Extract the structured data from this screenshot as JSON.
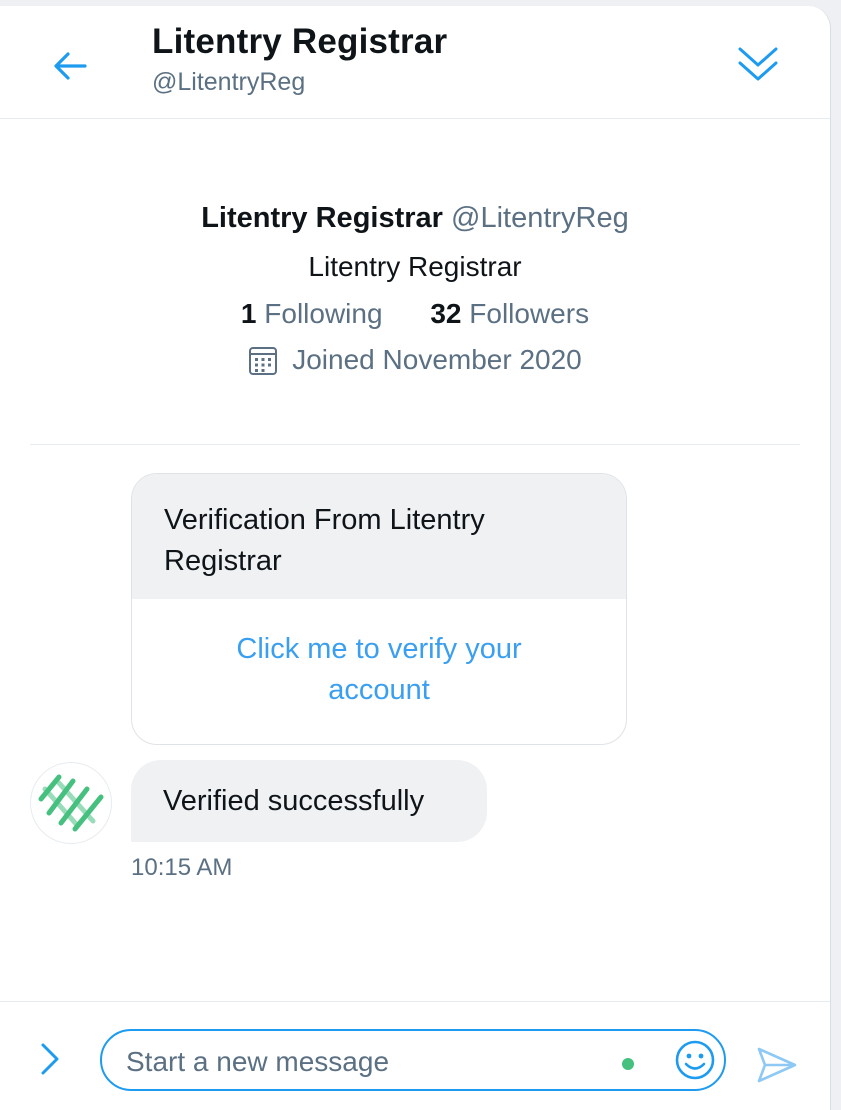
{
  "header": {
    "title": "Litentry Registrar",
    "handle": "@LitentryReg",
    "back_icon": "arrow-left-icon",
    "collapse_icon": "double-chevron-down-icon"
  },
  "profile": {
    "name": "Litentry Registrar",
    "handle": "@LitentryReg",
    "bio": "Litentry Registrar",
    "following_count": "1",
    "following_label": "Following",
    "followers_count": "32",
    "followers_label": "Followers",
    "joined": "Joined November 2020",
    "calendar_icon": "calendar-icon"
  },
  "messages": {
    "card_title": "Verification From Litentry Registrar",
    "card_link": "Click me to verify your account",
    "bubble_text": "Verified successfully",
    "timestamp": "10:15 AM",
    "avatar_icon": "litentry-logo-icon"
  },
  "composer": {
    "placeholder": "Start a new message",
    "expand_icon": "chevron-right-icon",
    "emoji_icon": "smiley-icon",
    "send_icon": "send-icon"
  },
  "colors": {
    "accent": "#1d9bf0",
    "link": "#3a9ff0",
    "muted_text": "#5b7083",
    "bubble_bg": "#eff1f3",
    "logo_green": "#45c07f"
  }
}
